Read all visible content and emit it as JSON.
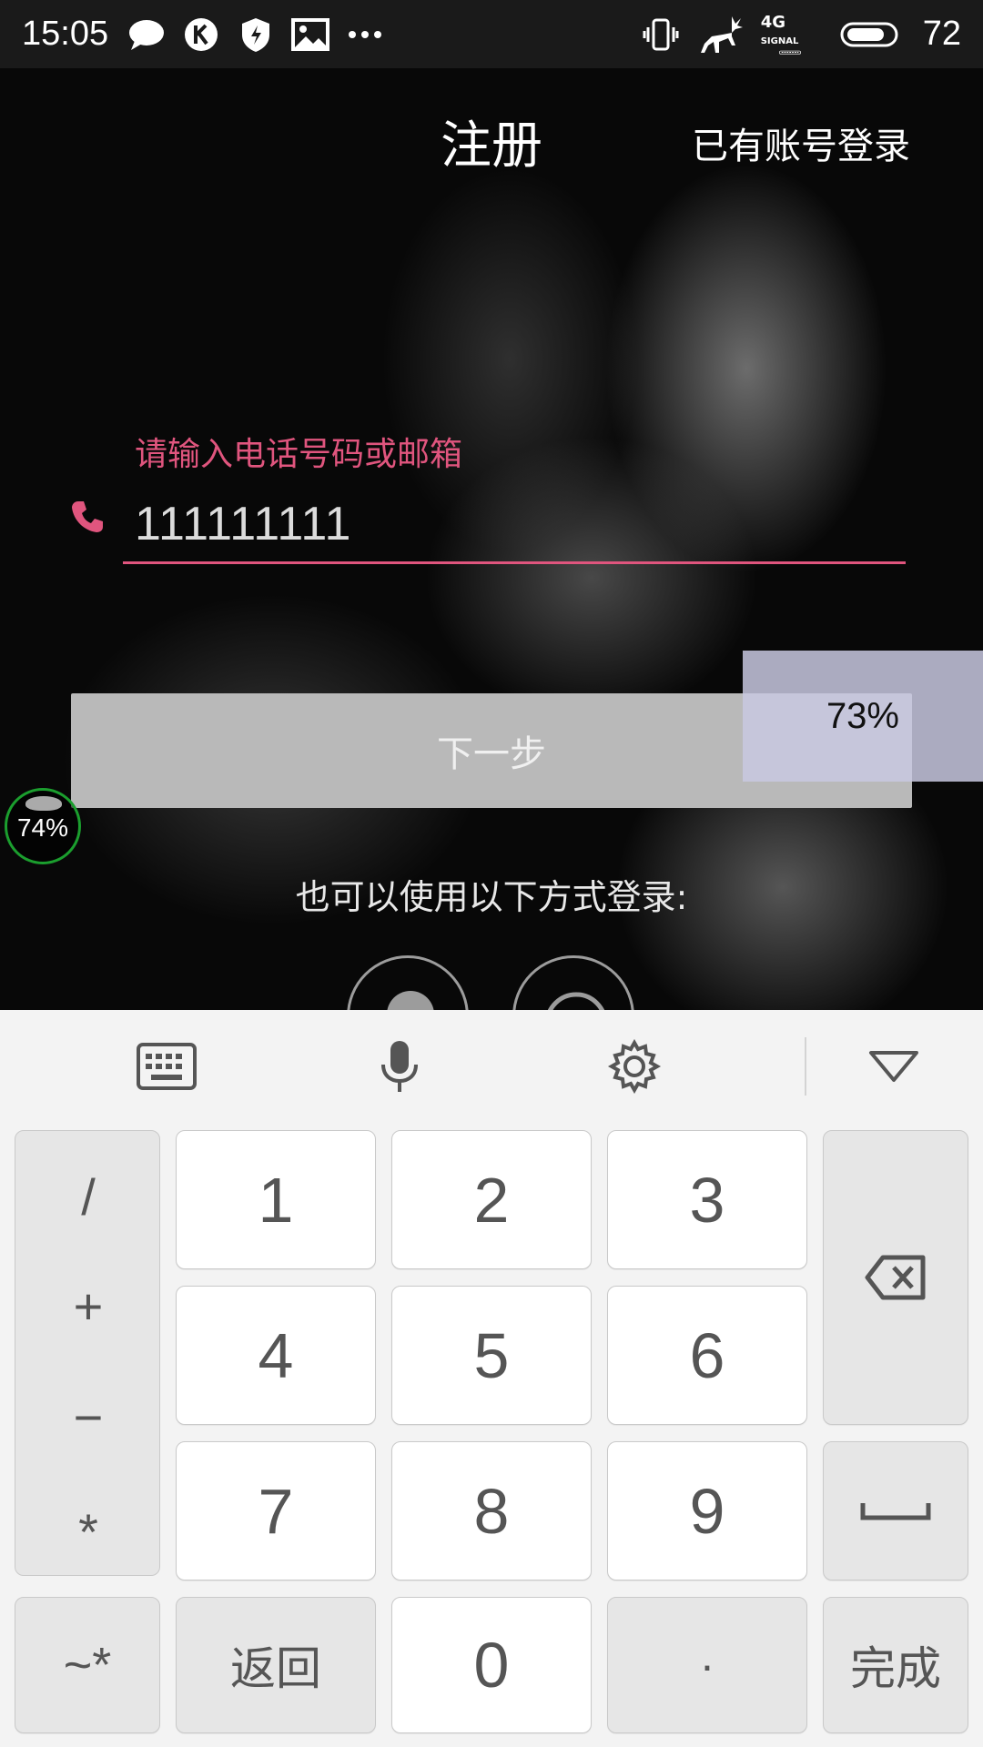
{
  "status_bar": {
    "time": "15:05",
    "battery": "72",
    "network": "4G",
    "signal_label": "SIGNAL",
    "left_icons": [
      "chat-bubble-icon",
      "k-app-icon",
      "shield-icon",
      "image-icon",
      "more-dots-icon"
    ],
    "right_icons": [
      "vibrate-icon",
      "deer-icon",
      "signal-icon",
      "battery-icon"
    ]
  },
  "header": {
    "title": "注册",
    "login_link": "已有账号登录"
  },
  "form": {
    "hint": "请输入电话号码或邮箱",
    "phone_value": "111111111",
    "accent": "#e0557e"
  },
  "next_button": {
    "label": "下一步"
  },
  "overlay": {
    "progress": "73%"
  },
  "float_bubble": {
    "progress": "74%",
    "color": "#1b9e2e"
  },
  "alt_login": {
    "label": "也可以使用以下方式登录:"
  },
  "keyboard": {
    "toolbar": [
      "keyboard-icon",
      "microphone-icon",
      "settings-gear-icon",
      "collapse-triangle-icon"
    ],
    "symbols": [
      "/",
      "+",
      "−",
      "*"
    ],
    "digits": [
      "1",
      "2",
      "3",
      "4",
      "5",
      "6",
      "7",
      "8",
      "9",
      "0"
    ],
    "bottom_left": "~*",
    "back": "返回",
    "dot": "·",
    "done": "完成"
  }
}
